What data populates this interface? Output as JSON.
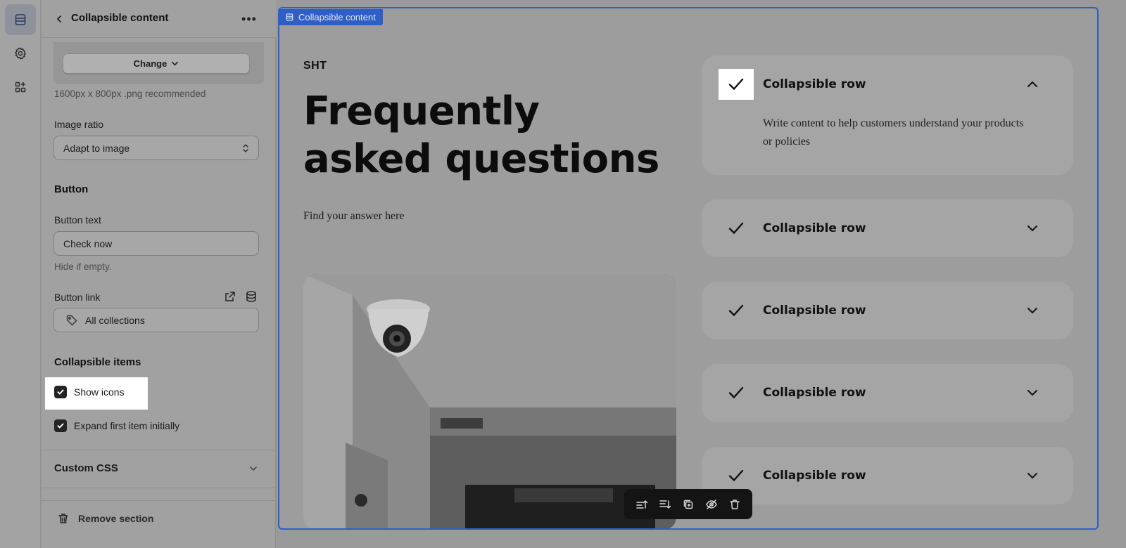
{
  "rail": {
    "items": [
      {
        "icon": "sections-icon",
        "active": true
      },
      {
        "icon": "gear-icon",
        "active": false
      },
      {
        "icon": "apps-icon",
        "active": false
      }
    ]
  },
  "panel": {
    "title": "Collapsible content",
    "more_label": "•••",
    "change_button": "Change",
    "image_hint": "1600px x 800px .png recommended",
    "image_ratio_label": "Image ratio",
    "image_ratio_value": "Adapt to image",
    "button_heading": "Button",
    "button_text_label": "Button text",
    "button_text_value": "Check now",
    "button_text_hint": "Hide if empty.",
    "button_link_label": "Button link",
    "button_link_value": "All collections",
    "collapsible_heading": "Collapsible items",
    "show_icons_label": "Show icons",
    "show_icons_checked": true,
    "expand_first_label": "Expand first item initially",
    "expand_first_checked": true,
    "custom_css_label": "Custom CSS",
    "remove_label": "Remove section"
  },
  "preview": {
    "tag_label": "Collapsible content",
    "eyebrow": "SHT",
    "title": "Frequently asked questions",
    "subtitle": "Find your answer here",
    "rows": [
      {
        "title": "Collapsible row",
        "expanded": true,
        "body": "Write content to help customers understand your products or policies"
      },
      {
        "title": "Collapsible row",
        "expanded": false
      },
      {
        "title": "Collapsible row",
        "expanded": false
      },
      {
        "title": "Collapsible row",
        "expanded": false
      },
      {
        "title": "Collapsible row",
        "expanded": false
      }
    ],
    "toolbar": [
      "move-up-icon",
      "move-down-icon",
      "duplicate-icon",
      "hide-icon",
      "trash-icon"
    ]
  },
  "colors": {
    "selection_border": "#2f5fc4",
    "checkbox": "#242424",
    "toolbar_bg": "#141414"
  }
}
